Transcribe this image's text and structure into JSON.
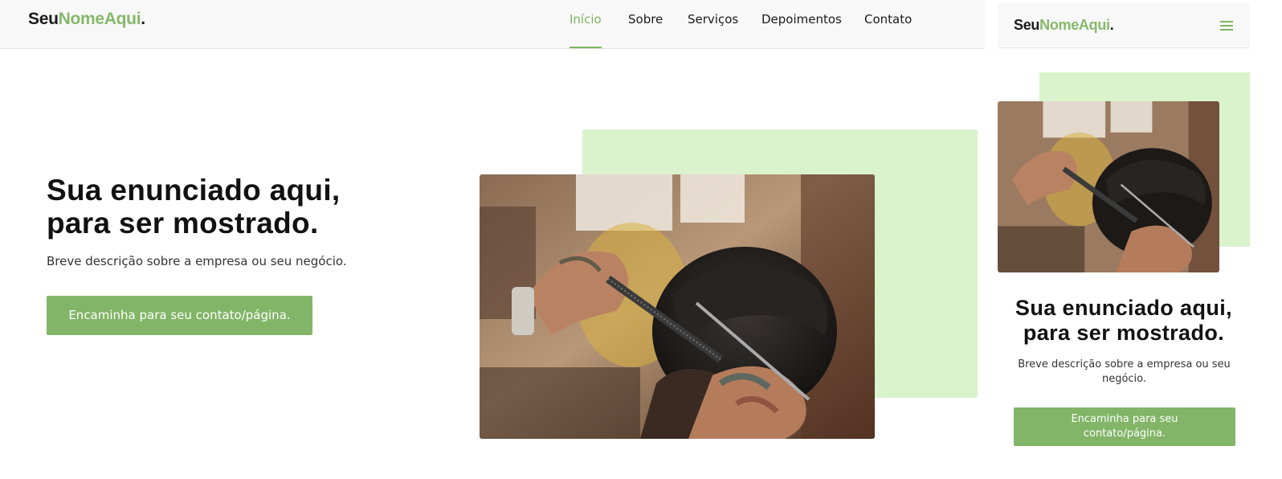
{
  "brand": {
    "part1": "Seu",
    "part2": "NomeAqui",
    "part3": "."
  },
  "nav": [
    {
      "label": "Início",
      "active": true
    },
    {
      "label": "Sobre",
      "active": false
    },
    {
      "label": "Serviços",
      "active": false
    },
    {
      "label": "Depoimentos",
      "active": false
    },
    {
      "label": "Contato",
      "active": false
    }
  ],
  "hero": {
    "title_line1": "Sua enunciado aqui,",
    "title_line2": "para ser mostrado.",
    "description": "Breve descrição sobre a empresa ou seu negócio.",
    "cta": "Encaminha para seu contato/página."
  },
  "photo": {
    "subject": "barber cutting hair with comb and scissors"
  },
  "icons": {
    "menu": "hamburger-menu-icon"
  },
  "colors": {
    "accent": "#82b567",
    "accent_text": "#7fb661",
    "accent_light": "#daf3cc",
    "header_bg": "#f8f8f8"
  }
}
